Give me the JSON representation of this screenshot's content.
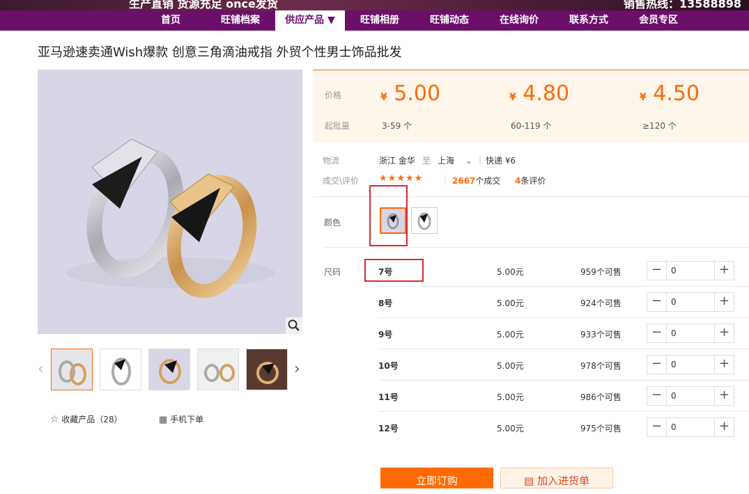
{
  "banner": {
    "left_text": "生产直销 货源充足 once发货",
    "right_text": "销售热线：13588898"
  },
  "nav": {
    "items": [
      "首页",
      "旺铺档案",
      "供应产品 ▼",
      "旺铺相册",
      "旺铺动态",
      "在线询价",
      "联系方式",
      "会员专区"
    ],
    "active_index": 2
  },
  "product": {
    "title": "亚马逊速卖通Wish爆款 创意三角滴油戒指 外贸个性男士饰品批发"
  },
  "gallery": {
    "zoom_icon": "magnifier-icon",
    "favorite_label": "收藏产品（28）",
    "mobile_order_label": "手机下单"
  },
  "pricing": {
    "price_label": "价格",
    "moq_label": "起批量",
    "currency_symbol": "¥",
    "tiers": [
      {
        "price": "5.00",
        "range": "3-59 个"
      },
      {
        "price": "4.80",
        "range": "60-119 个"
      },
      {
        "price": "4.50",
        "range": "≥120 个"
      }
    ]
  },
  "logistics": {
    "label": "物流",
    "from": "浙江 金华",
    "to_word": "至",
    "to": "上海",
    "shipping": "快递 ¥6"
  },
  "rating": {
    "label": "成交\\评价",
    "stars": 5,
    "deals_count": "2667",
    "deals_suffix": "个成交",
    "reviews_count": "4",
    "reviews_suffix": "条评价"
  },
  "color": {
    "label": "颜色",
    "selected_index": 0
  },
  "sizes": {
    "label": "尺码",
    "rows": [
      {
        "name": "7号",
        "price": "5.00元",
        "stock": "959个可售",
        "qty": "0"
      },
      {
        "name": "8号",
        "price": "5.00元",
        "stock": "924个可售",
        "qty": "0"
      },
      {
        "name": "9号",
        "price": "5.00元",
        "stock": "933个可售",
        "qty": "0"
      },
      {
        "name": "10号",
        "price": "5.00元",
        "stock": "978个可售",
        "qty": "0"
      },
      {
        "name": "11号",
        "price": "5.00元",
        "stock": "986个可售",
        "qty": "0"
      },
      {
        "name": "12号",
        "price": "5.00元",
        "stock": "975个可售",
        "qty": "0"
      }
    ]
  },
  "actions": {
    "order_label": "立即订购",
    "cart_label": "加入进货单"
  },
  "colors": {
    "accent": "#ff6a00",
    "nav_bg": "#6b0f6b",
    "highlight": "#e0252d"
  }
}
